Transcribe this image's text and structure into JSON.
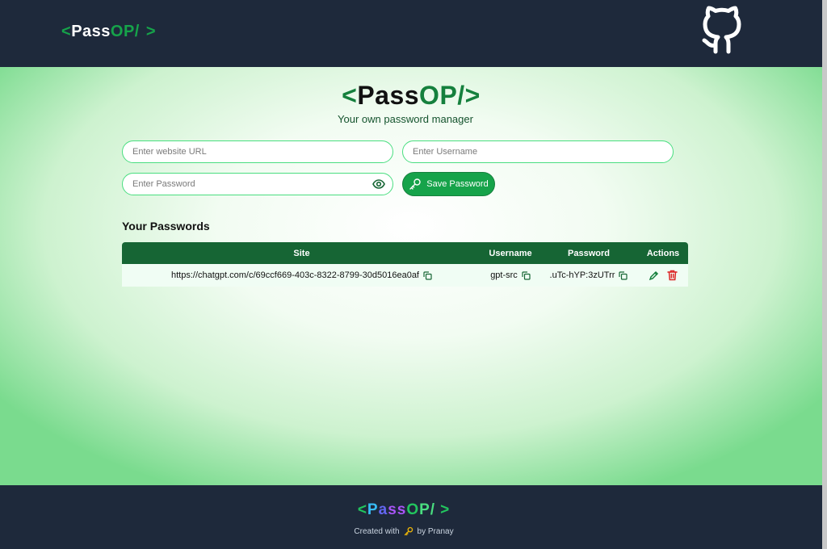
{
  "nav": {
    "logo": {
      "open": "<",
      "pass": "Pass",
      "op": "OP/",
      "close": ">"
    },
    "github_icon": "github-icon"
  },
  "hero": {
    "logo": {
      "open": "<",
      "pass": "Pass",
      "op": "OP/",
      "close": ">"
    },
    "tagline": "Your own password manager"
  },
  "form": {
    "url_placeholder": "Enter website URL",
    "username_placeholder": "Enter Username",
    "password_placeholder": "Enter Password",
    "save_label": "Save Password",
    "eye_icon": "eye-icon",
    "key_icon": "key-icon"
  },
  "passwords": {
    "title": "Your Passwords",
    "columns": [
      "Site",
      "Username",
      "Password",
      "Actions"
    ],
    "rows": [
      {
        "site": "https://chatgpt.com/c/69ccf669-403c-8322-8799-30d5016ea0af",
        "username": "gpt-src",
        "password": ".uTc-hYP:3zUTrr"
      }
    ]
  },
  "footer": {
    "logo": {
      "lt": "<",
      "p": "P",
      "a": "a",
      "ss": "ss",
      "o": "O",
      "p2": "P",
      "slash": "/",
      "gt": ">"
    },
    "credit_before": "Created with",
    "credit_after": "by Pranay",
    "credit_icon": "key-icon"
  },
  "colors": {
    "nav_bg": "#1e293b",
    "accent": "#16a34a",
    "table_header": "#166534",
    "delete": "#dc2626"
  }
}
